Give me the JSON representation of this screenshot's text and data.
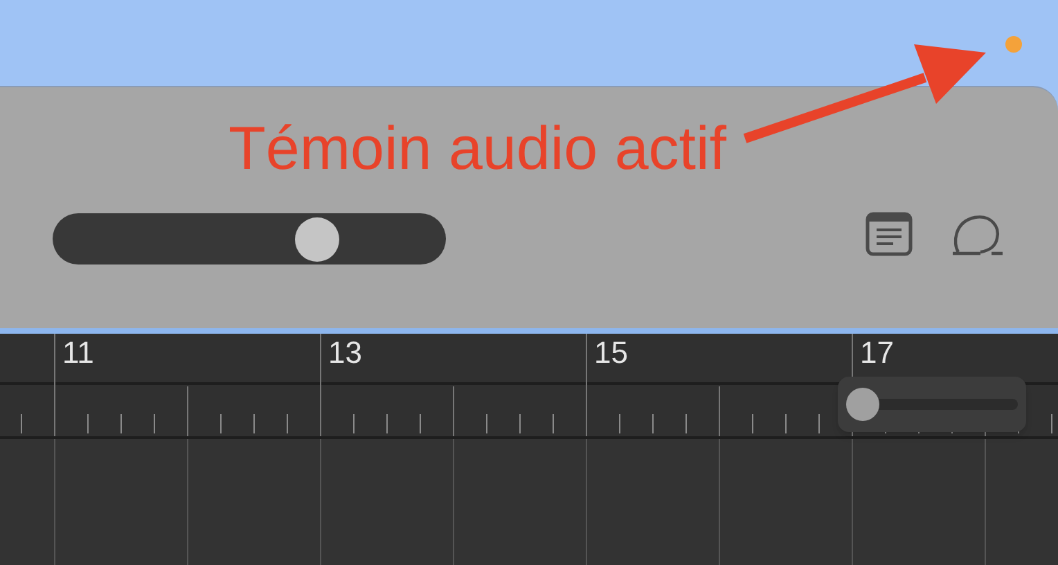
{
  "audio_indicator": {
    "on": true
  },
  "annotation": {
    "text": "Témoin audio actif"
  },
  "toolbar": {
    "master_volume": {
      "level": 0.7
    }
  },
  "ruler": {
    "bars": [
      {
        "label": "11"
      },
      {
        "label": "13"
      },
      {
        "label": "15"
      },
      {
        "label": "17"
      }
    ]
  },
  "zoom_slider": {
    "level": 0
  }
}
